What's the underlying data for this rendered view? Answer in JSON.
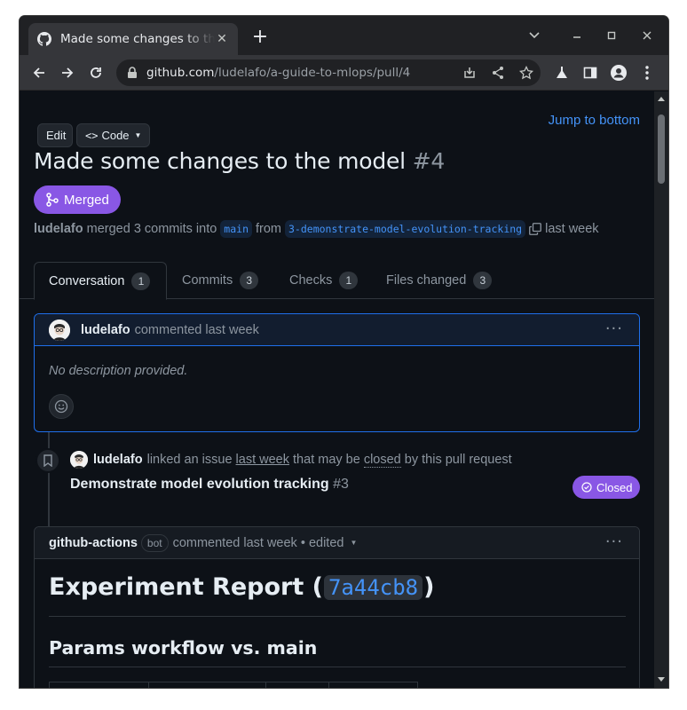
{
  "browser": {
    "tab_title": "Made some changes to the model #4",
    "url_host": "github.com",
    "url_path": "/ludelafo/a-guide-to-mlops/pull/4"
  },
  "header": {
    "edit_label": "Edit",
    "code_label": "Code",
    "jump_label": "Jump to bottom"
  },
  "pr": {
    "title": "Made some changes to the model",
    "number": "#4",
    "state": "Merged",
    "author": "ludelafo",
    "merge_text": "merged 3 commits into",
    "base_branch": "main",
    "from_text": "from",
    "head_branch": "3-demonstrate-model-evolution-tracking",
    "time": "last week"
  },
  "tabs": [
    {
      "label": "Conversation",
      "count": "1"
    },
    {
      "label": "Commits",
      "count": "3"
    },
    {
      "label": "Checks",
      "count": "1"
    },
    {
      "label": "Files changed",
      "count": "3"
    }
  ],
  "comment1": {
    "author": "ludelafo",
    "meta": "commented last week",
    "body": "No description provided."
  },
  "linked": {
    "author": "ludelafo",
    "text_a": "linked an issue",
    "time": "last week",
    "text_b": "that may be",
    "closed_word": "closed",
    "text_c": "by this pull request",
    "issue_title": "Demonstrate model evolution tracking",
    "issue_number": "#3",
    "badge": "Closed"
  },
  "comment2": {
    "author": "github-actions",
    "bot_label": "bot",
    "meta": "commented last week • edited",
    "report_prefix": "Experiment Report (",
    "report_sha": "7a44cb8",
    "report_suffix": ")",
    "params_heading": "Params workflow vs. main"
  }
}
